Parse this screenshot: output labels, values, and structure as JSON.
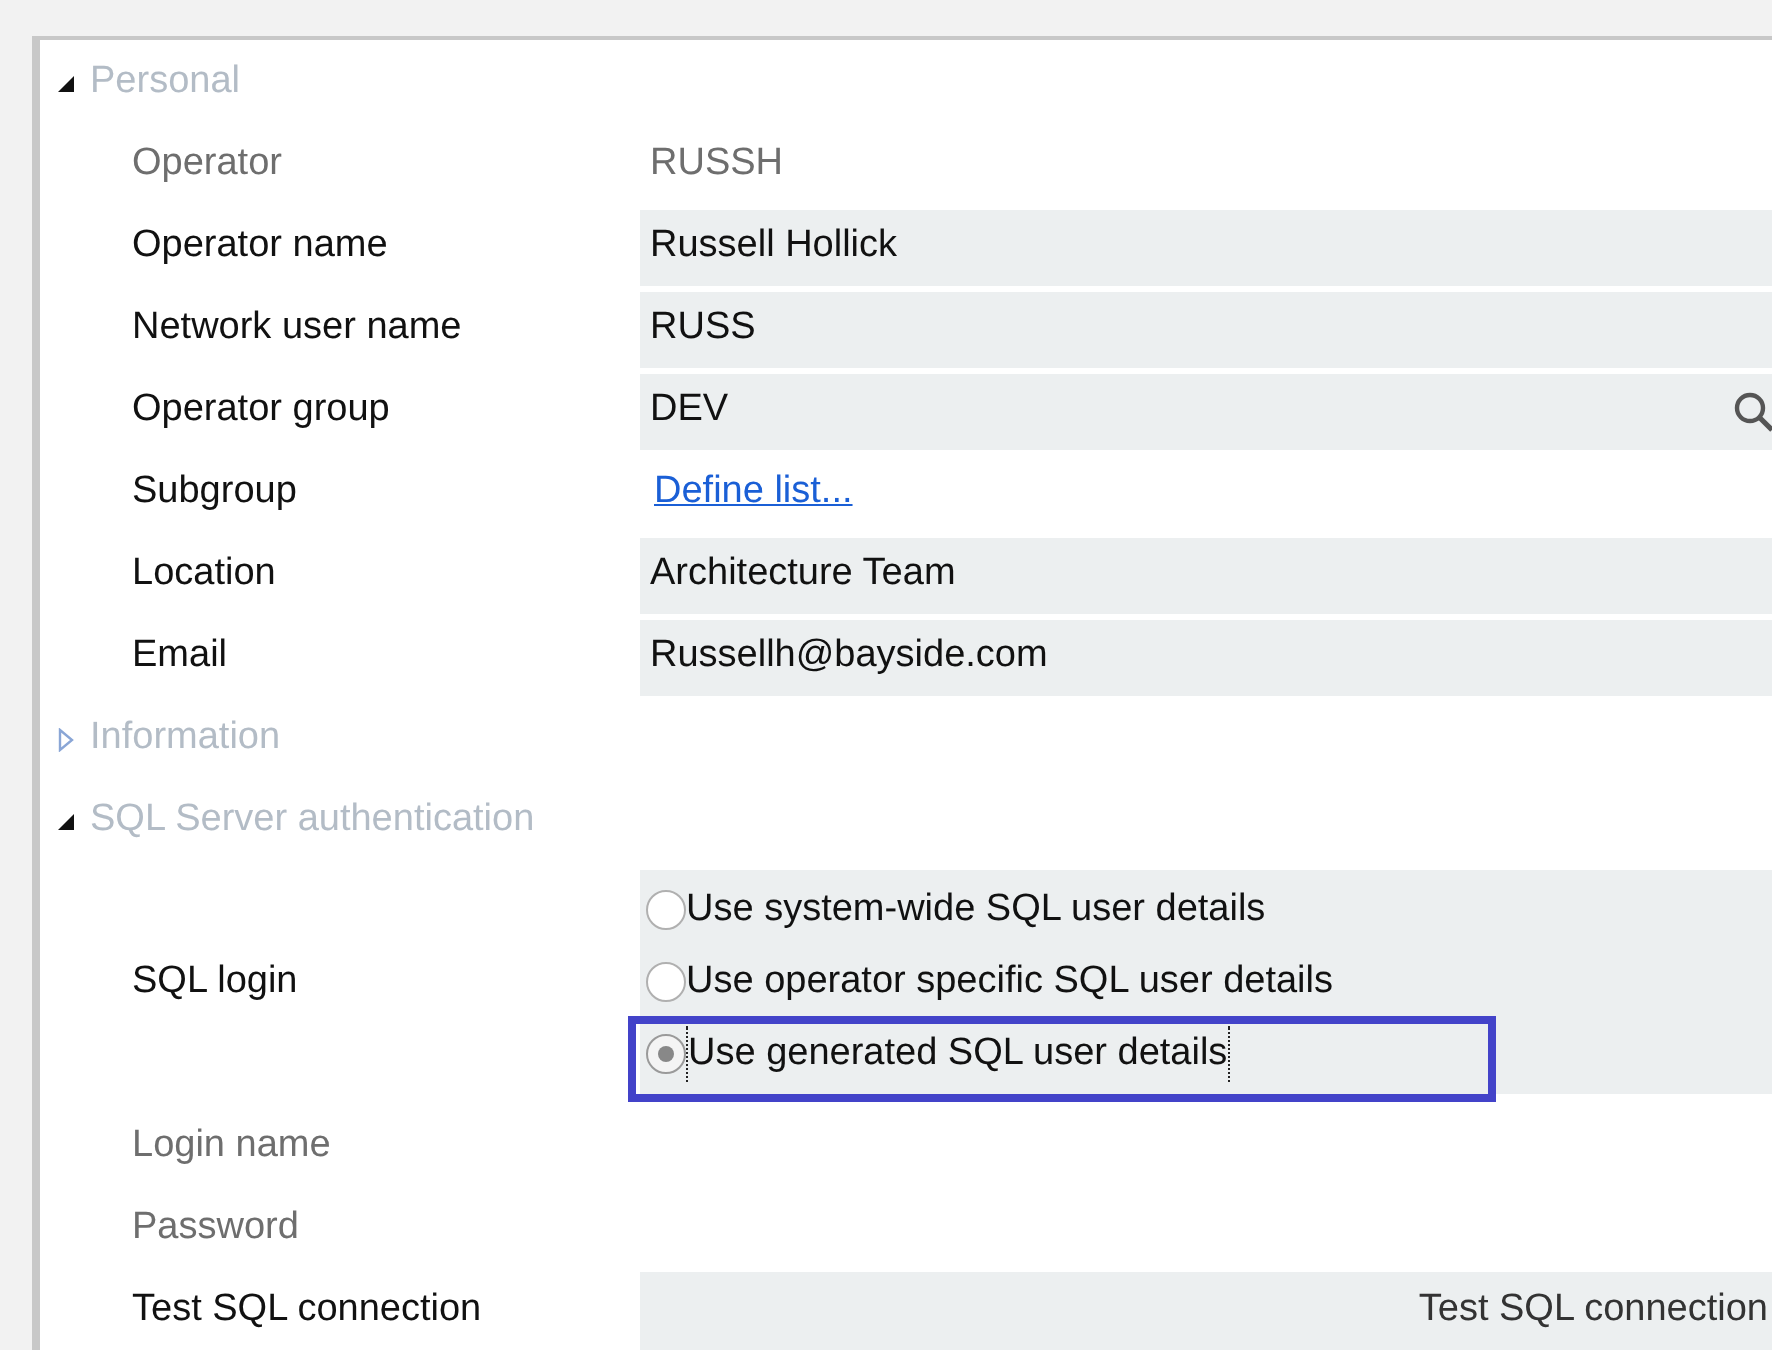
{
  "sections": [
    {
      "title": "Personal",
      "expanded": true,
      "fields": [
        {
          "kind": "readonly",
          "label": "Operator",
          "disabled": true,
          "value": "RUSSH"
        },
        {
          "kind": "text",
          "label": "Operator name",
          "disabled": false,
          "value": "Russell Hollick"
        },
        {
          "kind": "text",
          "label": "Network user name",
          "disabled": false,
          "value": "RUSS"
        },
        {
          "kind": "lookup",
          "label": "Operator group",
          "disabled": false,
          "value": "DEV"
        },
        {
          "kind": "link",
          "label": "Subgroup",
          "disabled": false,
          "value": "Define list..."
        },
        {
          "kind": "text",
          "label": "Location",
          "disabled": false,
          "value": "Architecture Team"
        },
        {
          "kind": "text",
          "label": "Email",
          "disabled": false,
          "value": "Russellh@bayside.com"
        }
      ]
    },
    {
      "title": "Information",
      "expanded": false
    },
    {
      "title": "SQL Server authentication",
      "expanded": true,
      "fields": [
        {
          "kind": "radio",
          "label": "SQL login",
          "disabled": false,
          "options": [
            {
              "label": "Use system-wide SQL user details",
              "selected": false,
              "highlighted": false
            },
            {
              "label": "Use operator specific SQL user details",
              "selected": false,
              "highlighted": false
            },
            {
              "label": "Use generated SQL user details",
              "selected": true,
              "highlighted": true
            }
          ]
        },
        {
          "kind": "empty",
          "label": "Login name",
          "disabled": true
        },
        {
          "kind": "empty",
          "label": "Password",
          "disabled": true
        },
        {
          "kind": "button",
          "label": "Test SQL connection",
          "disabled": false,
          "value": "Test SQL connection"
        }
      ]
    }
  ]
}
